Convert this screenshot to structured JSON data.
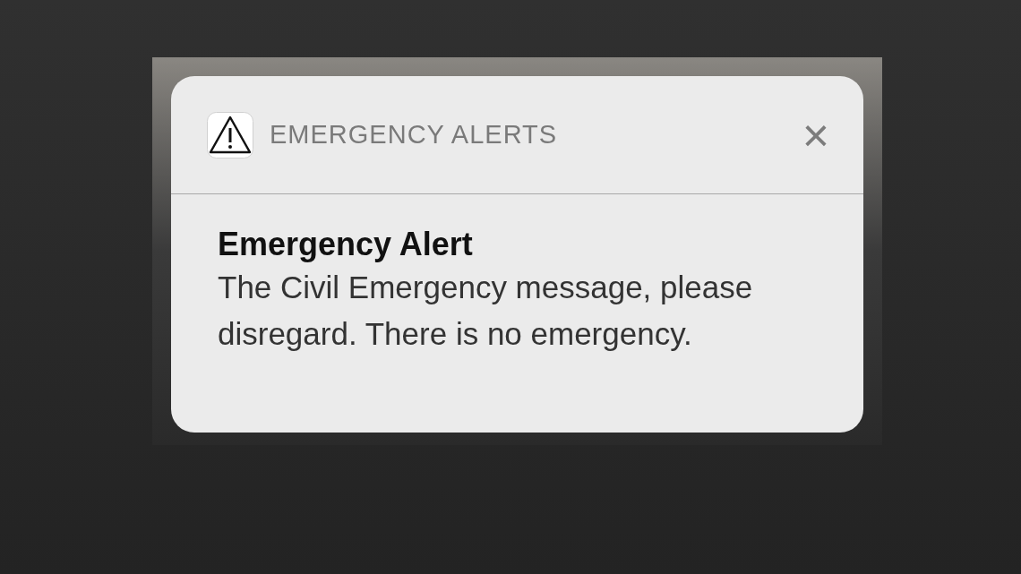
{
  "notification": {
    "app_name": "EMERGENCY ALERTS",
    "close": "×",
    "title": "Emergency Alert",
    "message": "The Civil Emergency message, please disregard. There is no emergency."
  }
}
